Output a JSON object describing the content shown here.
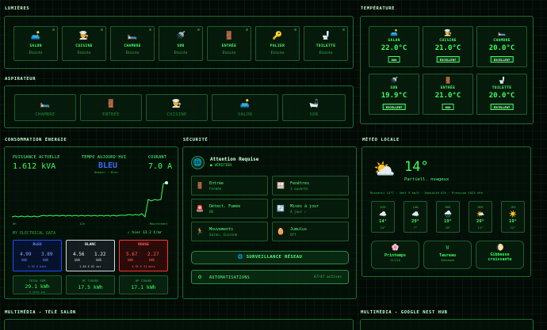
{
  "lights": {
    "title": "LUMIÈRES",
    "items": [
      {
        "name": "SALON",
        "state": "Éteinte",
        "icon": "sofa-lamp-icon"
      },
      {
        "name": "CUISINE",
        "state": "Éteinte",
        "icon": "chef-icon"
      },
      {
        "name": "CHAMBRE",
        "state": "Éteinte",
        "icon": "bed-icon"
      },
      {
        "name": "SDB",
        "state": "Éteinte",
        "icon": "shower-icon"
      },
      {
        "name": "ENTRÉE",
        "state": "Éteinte",
        "icon": "door-icon"
      },
      {
        "name": "PALIER",
        "state": "Éteinte",
        "icon": "key-icon"
      },
      {
        "name": "TOILETTE",
        "state": "Éteinte",
        "icon": "toilet-icon"
      }
    ]
  },
  "vacuum": {
    "title": "ASPIRATEUR",
    "items": [
      {
        "name": "CHAMBRE",
        "icon": "bed-icon"
      },
      {
        "name": "ENTRÉE",
        "icon": "door-icon"
      },
      {
        "name": "CUISINE",
        "icon": "chef-icon"
      },
      {
        "name": "SALON",
        "icon": "sofa-icon"
      },
      {
        "name": "SDB",
        "icon": "bathtub-icon"
      }
    ]
  },
  "temperature": {
    "title": "TEMPÉRATURE",
    "items": [
      {
        "name": "SALON",
        "value": "22.0°C",
        "badge": "BON"
      },
      {
        "name": "CUISINE",
        "value": "21.0°C",
        "badge": "EXCELLENT"
      },
      {
        "name": "CHAMBRE",
        "value": "20.0°C",
        "badge": "EXCELLENT"
      },
      {
        "name": "SDB",
        "value": "19.9°C",
        "badge": "EXCELLENT"
      },
      {
        "name": "ENTRÉE",
        "value": "21.0°C",
        "badge": "BON"
      },
      {
        "name": "TOILETTE",
        "value": "20.0°C",
        "badge": "EXCELLENT"
      }
    ]
  },
  "energy": {
    "title": "CONSOMMATION ÉNERGIE",
    "power_label": "PUISSANCE ACTUELLE",
    "power_value": "1.612 kVA",
    "tempo_label": "TEMPO AUJOURD'HUI",
    "tempo_value": "BLEU",
    "tempo_sub": "Demain : Bleu",
    "current_label": "COURANT",
    "current_value": "7.0 A",
    "axis_left": "0h",
    "axis_mid": "12h",
    "axis_right": "Maintenant",
    "my_data_label": "MY ELECTRICAL DATA",
    "my_data_value": "✓ hier 13.2 €/mr",
    "segments": [
      {
        "title": "BLEU",
        "hc": "4.99",
        "hp": "3.89",
        "unit": "kWh",
        "foot": "3.32 € hier"
      },
      {
        "title": "BLANC",
        "hc": "4.56",
        "hp": "1.22",
        "unit": "kWh",
        "foot": "1.84 € 02 avr"
      },
      {
        "title": "ROUGE",
        "hc": "5.67",
        "hp": "2.27",
        "unit": "kWh",
        "foot": "4.35 € 31 mars"
      }
    ],
    "totals": [
      {
        "label": "TOTAL SEM",
        "value": "29.1 kWh",
        "sub": "€ cette sem"
      },
      {
        "label": "HC 7JOURS",
        "value": "17.5 kWh"
      },
      {
        "label": "HP 7JOURS",
        "value": "17.1 kWh"
      }
    ],
    "colors": {
      "bleu": "#1a4fff",
      "blanc": "#e8f0ff",
      "rouge": "#ff3535"
    }
  },
  "security": {
    "title": "SÉCURITÉ",
    "alert_title": "Attention Requise",
    "alert_sub": "● VÉRIFIER",
    "items": [
      {
        "name": "Entrée",
        "state": "Fermée",
        "icon": "door-icon"
      },
      {
        "name": "Fenêtres",
        "state": "1 ouverte",
        "icon": "window-icon"
      },
      {
        "name": "Détect. Fumée",
        "state": "OK",
        "icon": "smoke-detector-icon"
      },
      {
        "name": "Mises à jour",
        "state": "À jour ✓",
        "icon": "update-icon"
      },
      {
        "name": "Mouvements",
        "state": "Salon, Cuisine",
        "icon": "running-person-icon"
      },
      {
        "name": "Jumulus",
        "state": "Off",
        "icon": "egg-icon"
      }
    ],
    "network_button": "SURVEILLANCE RÉSEAU",
    "automations_label": "AUTOMATISATIONS",
    "automations_value": "47/47 actives"
  },
  "weather": {
    "title": "MÉTÉO LOCALE",
    "temp": "14°",
    "condition": "Partiell. nuageux",
    "details": "Ressenti 14°C · Vent 5 km/h · Humidité 62% · Pression 1023 hPa",
    "forecast": [
      {
        "day": "DIM",
        "icon": "cloud-icon",
        "high": "14°",
        "low": "14°"
      },
      {
        "day": "LUN",
        "icon": "cloud-icon",
        "high": "20°",
        "low": "7°"
      },
      {
        "day": "MAR",
        "icon": "rain-cloud-icon",
        "high": "19°",
        "low": "10°"
      },
      {
        "day": "MER",
        "icon": "sun-cloud-icon",
        "high": "20°",
        "low": "11°"
      },
      {
        "day": "JEU",
        "icon": "sun-icon",
        "high": "19°",
        "low": "12°"
      }
    ],
    "astro": [
      {
        "name": "Printemps",
        "sub": "J2/J10",
        "icon": "flower-icon"
      },
      {
        "name": "Taureau",
        "sub": "Zodiaque",
        "icon": "taurus-icon"
      },
      {
        "name": "Gibbeuse croissante",
        "sub": "",
        "icon": "moon-icon"
      }
    ]
  },
  "media_salon": {
    "title": "MULTIMÉDIA - TÉLÉ SALON"
  },
  "media_hub": {
    "title": "MULTIMÉDIA - GOOGLE NEST HUB"
  }
}
